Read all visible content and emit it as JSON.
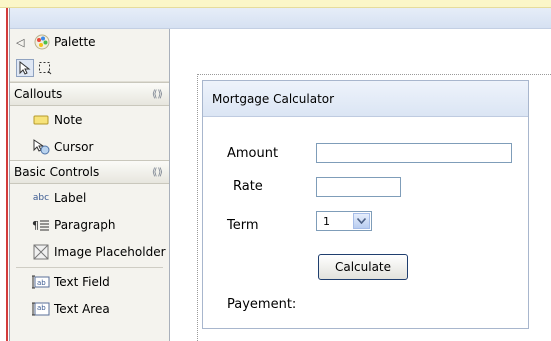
{
  "palette": {
    "title": "Palette",
    "drawers": [
      {
        "label": "Callouts",
        "items": [
          {
            "label": "Note",
            "icon": "note-icon"
          },
          {
            "label": "Cursor",
            "icon": "cursor-icon"
          }
        ]
      },
      {
        "label": "Basic Controls",
        "items": [
          {
            "label": "Label",
            "icon": "label-icon",
            "icon_text": "abc"
          },
          {
            "label": "Paragraph",
            "icon": "paragraph-icon"
          },
          {
            "label": "Image Placeholder",
            "icon": "image-placeholder-icon"
          },
          {
            "label": "Text Field",
            "icon": "text-field-icon"
          },
          {
            "label": "Text Area",
            "icon": "text-area-icon"
          }
        ]
      }
    ]
  },
  "form": {
    "title": "Mortgage Calculator",
    "amount_label": "Amount",
    "rate_label": "Rate",
    "term_label": "Term",
    "term_value": "1",
    "button_label": "Calculate",
    "payment_label": "Payement:"
  },
  "colors": {
    "accent": "#7f9db9",
    "marker": "#d23c3c",
    "button_border": "#1f3e6e"
  }
}
